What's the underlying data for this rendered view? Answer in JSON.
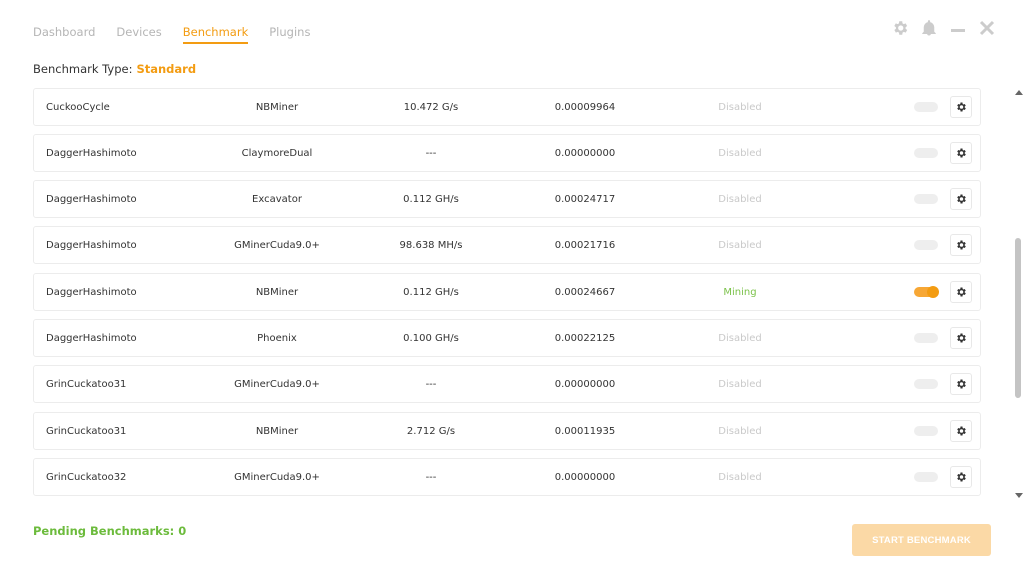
{
  "nav": {
    "tabs": [
      {
        "label": "Dashboard"
      },
      {
        "label": "Devices"
      },
      {
        "label": "Benchmark",
        "active": true
      },
      {
        "label": "Plugins"
      }
    ]
  },
  "top_icons": [
    "settings-gear-icon",
    "notification-bell-icon",
    "minimize-icon",
    "close-icon"
  ],
  "benchmark_type": {
    "label": "Benchmark Type:",
    "value": "Standard"
  },
  "rows": [
    {
      "algorithm": "CuckooCycle",
      "miner": "NBMiner",
      "speed": "10.472 G/s",
      "profit": "0.00009964",
      "status": "Disabled",
      "enabled": false
    },
    {
      "algorithm": "DaggerHashimoto",
      "miner": "ClaymoreDual",
      "speed": "---",
      "profit": "0.00000000",
      "status": "Disabled",
      "enabled": false
    },
    {
      "algorithm": "DaggerHashimoto",
      "miner": "Excavator",
      "speed": "0.112 GH/s",
      "profit": "0.00024717",
      "status": "Disabled",
      "enabled": false
    },
    {
      "algorithm": "DaggerHashimoto",
      "miner": "GMinerCuda9.0+",
      "speed": "98.638 MH/s",
      "profit": "0.00021716",
      "status": "Disabled",
      "enabled": false
    },
    {
      "algorithm": "DaggerHashimoto",
      "miner": "NBMiner",
      "speed": "0.112 GH/s",
      "profit": "0.00024667",
      "status": "Mining",
      "enabled": true
    },
    {
      "algorithm": "DaggerHashimoto",
      "miner": "Phoenix",
      "speed": "0.100 GH/s",
      "profit": "0.00022125",
      "status": "Disabled",
      "enabled": false
    },
    {
      "algorithm": "GrinCuckatoo31",
      "miner": "GMinerCuda9.0+",
      "speed": "---",
      "profit": "0.00000000",
      "status": "Disabled",
      "enabled": false
    },
    {
      "algorithm": "GrinCuckatoo31",
      "miner": "NBMiner",
      "speed": "2.712 G/s",
      "profit": "0.00011935",
      "status": "Disabled",
      "enabled": false
    },
    {
      "algorithm": "GrinCuckatoo32",
      "miner": "GMinerCuda9.0+",
      "speed": "---",
      "profit": "0.00000000",
      "status": "Disabled",
      "enabled": false
    }
  ],
  "footer": {
    "pending": "Pending Benchmarks: 0",
    "start_button": "START BENCHMARK"
  },
  "colors": {
    "accent": "#f39c12",
    "mining": "#7cc24b",
    "pending": "#6cbb3c",
    "disabled_text": "#c9c9c9"
  }
}
